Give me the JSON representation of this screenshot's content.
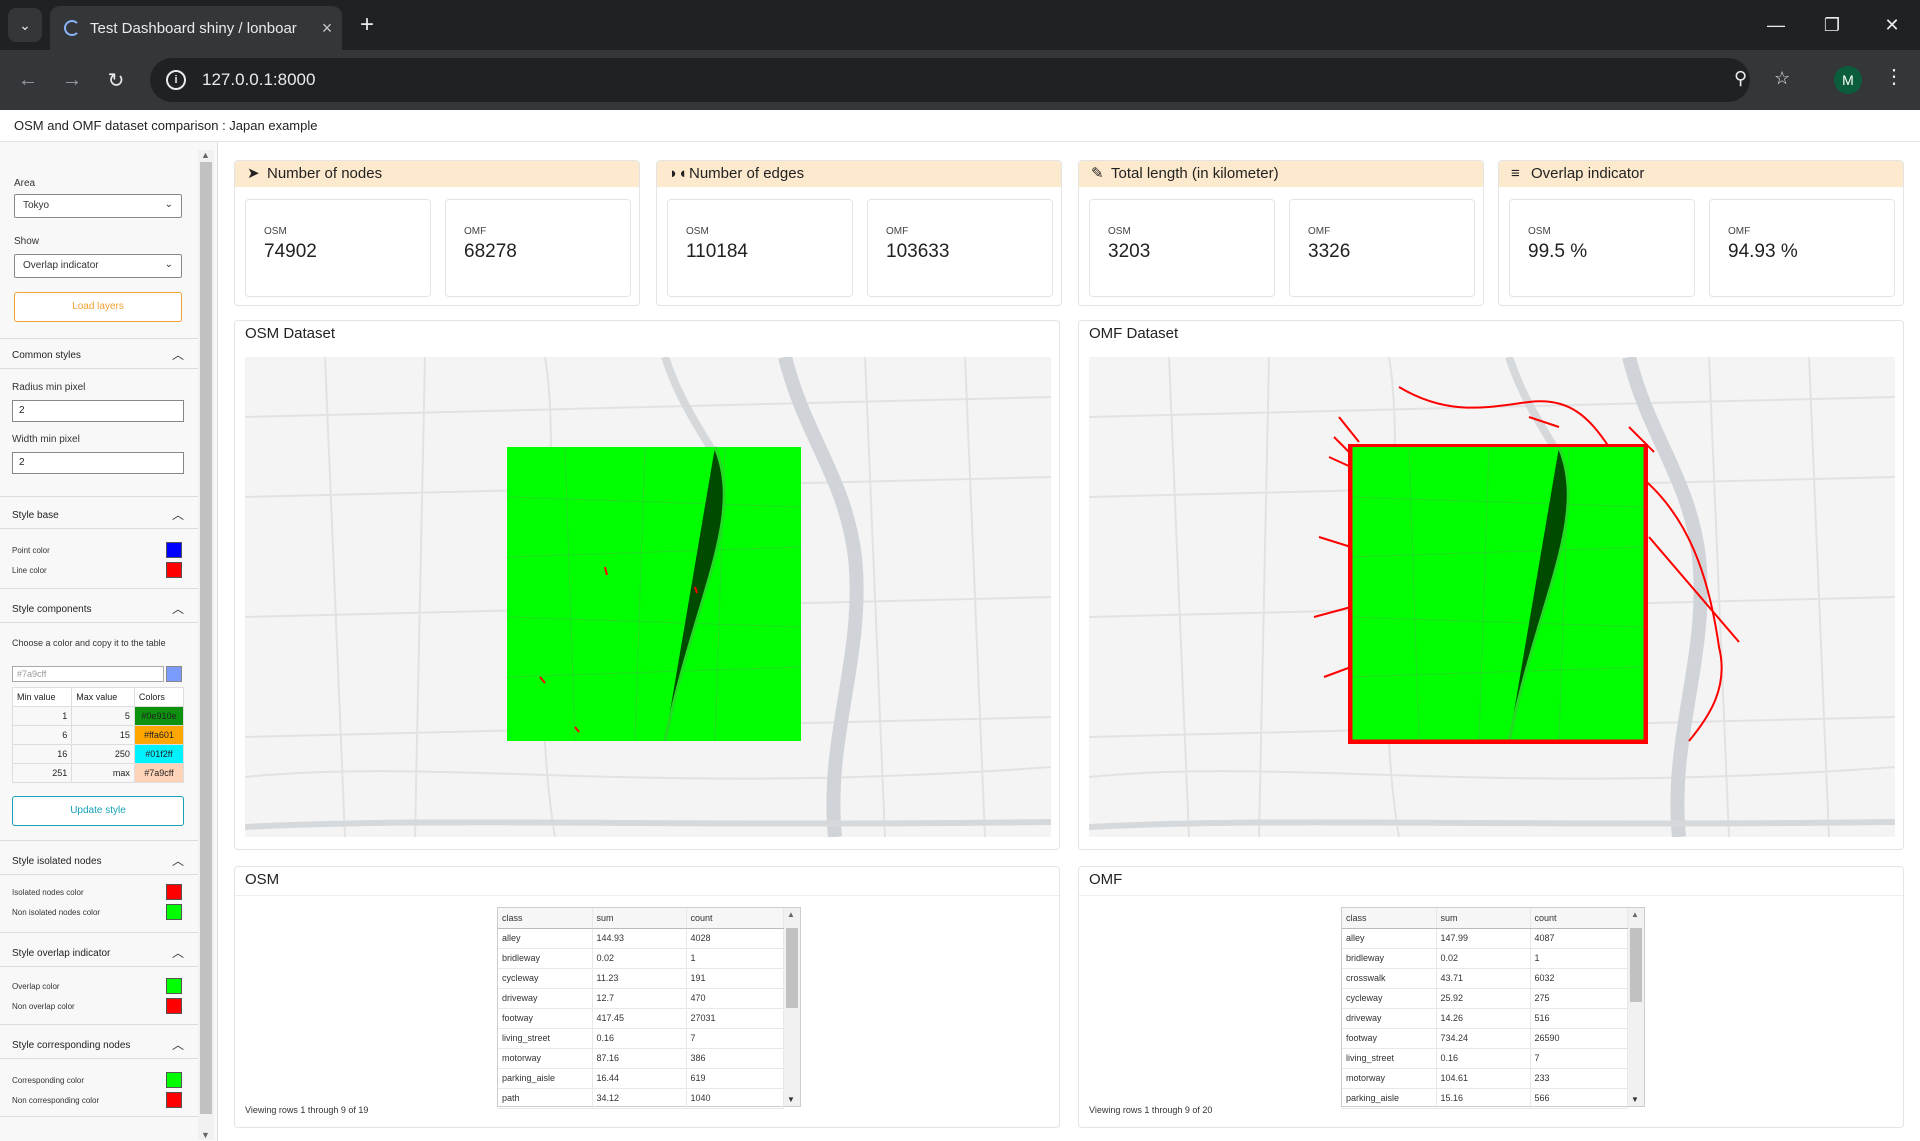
{
  "browser": {
    "tab_title": "Test Dashboard shiny / lonboar",
    "url": "127.0.0.1:8000",
    "profile_initial": "M"
  },
  "app": {
    "title": "OSM and OMF dataset comparison : Japan example"
  },
  "sidebar": {
    "area_label": "Area",
    "area_value": "Tokyo",
    "show_label": "Show",
    "show_value": "Overlap indicator",
    "load_button": "Load layers",
    "common_styles": {
      "title": "Common styles",
      "radius_label": "Radius min pixel",
      "radius_value": "2",
      "width_label": "Width min pixel",
      "width_value": "2"
    },
    "style_base": {
      "title": "Style base",
      "point_label": "Point color",
      "point_color": "#0000ff",
      "line_label": "Line color",
      "line_color": "#ff0000"
    },
    "style_components": {
      "title": "Style components",
      "hint": "Choose a color and copy it to the table",
      "color_input": "#7a9cff",
      "headers": [
        "Min value",
        "Max value",
        "Colors"
      ],
      "rows": [
        {
          "min": "1",
          "max": "5",
          "color": "#0e910e"
        },
        {
          "min": "6",
          "max": "15",
          "color": "#ffa601"
        },
        {
          "min": "16",
          "max": "250",
          "color": "#01f2ff"
        },
        {
          "min": "251",
          "max": "max",
          "color": "#7a9cff"
        }
      ],
      "update_button": "Update style"
    },
    "style_isolated": {
      "title": "Style isolated nodes",
      "iso_label": "Isolated nodes color",
      "iso_color": "#ff0000",
      "non_iso_label": "Non isolated nodes color",
      "non_iso_color": "#00ff00"
    },
    "style_overlap": {
      "title": "Style overlap indicator",
      "ov_label": "Overlap color",
      "ov_color": "#00ff00",
      "non_ov_label": "Non overlap color",
      "non_ov_color": "#ff0000"
    },
    "style_corresponding": {
      "title": "Style corresponding nodes",
      "c_label": "Corresponding color",
      "c_color": "#00ff00",
      "nc_label": "Non corresponding color",
      "nc_color": "#ff0000"
    }
  },
  "cards": [
    {
      "title": "Number of nodes",
      "icon": "send-icon",
      "osm_label": "OSM",
      "osm": "74902",
      "omf_label": "OMF",
      "omf": "68278"
    },
    {
      "title": "Number of edges",
      "icon": "binoculars-icon",
      "osm_label": "OSM",
      "osm": "110184",
      "omf_label": "OMF",
      "omf": "103633"
    },
    {
      "title": "Total length (in kilometer)",
      "icon": "ruler-icon",
      "osm_label": "OSM",
      "osm": "3203",
      "omf_label": "OMF",
      "omf": "3326"
    },
    {
      "title": "Overlap indicator",
      "icon": "equals-icon",
      "osm_label": "OSM",
      "osm": "99.5 %",
      "omf_label": "OMF",
      "omf": "94.93 %"
    }
  ],
  "maps": {
    "osm_title": "OSM Dataset",
    "omf_title": "OMF Dataset",
    "road_color": "#00ff00",
    "mismatch_color": "#ff0000"
  },
  "tables": {
    "osm": {
      "title": "OSM",
      "headers": [
        "class",
        "sum",
        "count"
      ],
      "rows": [
        [
          "alley",
          "144.93",
          "4028"
        ],
        [
          "bridleway",
          "0.02",
          "1"
        ],
        [
          "cycleway",
          "11.23",
          "191"
        ],
        [
          "driveway",
          "12.7",
          "470"
        ],
        [
          "footway",
          "417.45",
          "27031"
        ],
        [
          "living_street",
          "0.16",
          "7"
        ],
        [
          "motorway",
          "87.16",
          "386"
        ],
        [
          "parking_aisle",
          "16.44",
          "619"
        ],
        [
          "path",
          "34.12",
          "1040"
        ]
      ],
      "footer": "Viewing rows 1 through 9 of 19"
    },
    "omf": {
      "title": "OMF",
      "headers": [
        "class",
        "sum",
        "count"
      ],
      "rows": [
        [
          "alley",
          "147.99",
          "4087"
        ],
        [
          "bridleway",
          "0.02",
          "1"
        ],
        [
          "crosswalk",
          "43.71",
          "6032"
        ],
        [
          "cycleway",
          "25.92",
          "275"
        ],
        [
          "driveway",
          "14.26",
          "516"
        ],
        [
          "footway",
          "734.24",
          "26590"
        ],
        [
          "living_street",
          "0.16",
          "7"
        ],
        [
          "motorway",
          "104.61",
          "233"
        ],
        [
          "parking_aisle",
          "15.16",
          "566"
        ]
      ],
      "footer": "Viewing rows 1 through 9 of 20"
    }
  }
}
